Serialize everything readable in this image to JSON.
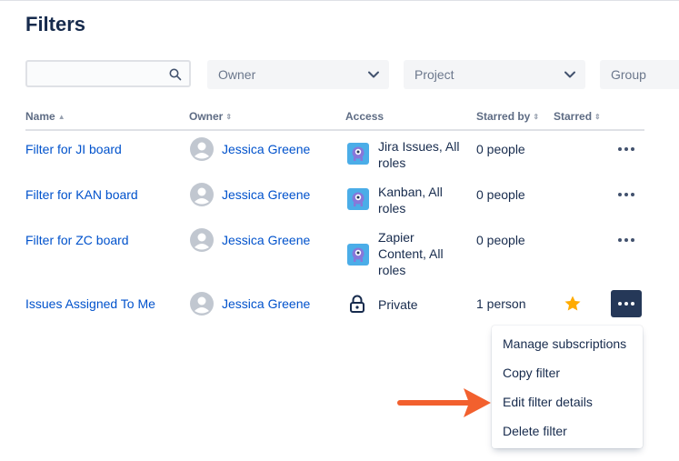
{
  "page": {
    "title": "Filters"
  },
  "filters": {
    "search_value": "",
    "owner_label": "Owner",
    "project_label": "Project",
    "group_label": "Group"
  },
  "columns": {
    "name": "Name",
    "owner": "Owner",
    "access": "Access",
    "starred_by": "Starred by",
    "starred": "Starred"
  },
  "rows": [
    {
      "name": "Filter for JI board",
      "owner": "Jessica Greene",
      "access": "Jira Issues, All roles",
      "access_icon": "project-icon",
      "starred_by": "0 people",
      "starred": false
    },
    {
      "name": "Filter for KAN board",
      "owner": "Jessica Greene",
      "access": "Kanban, All roles",
      "access_icon": "project-icon",
      "starred_by": "0 people",
      "starred": false
    },
    {
      "name": "Filter for ZC board",
      "owner": "Jessica Greene",
      "access": "Zapier Content, All roles",
      "access_icon": "project-icon",
      "starred_by": "0 people",
      "starred": false
    },
    {
      "name": "Issues Assigned To Me",
      "owner": "Jessica Greene",
      "access": "Private",
      "access_icon": "lock-icon",
      "starred_by": "1 person",
      "starred": true
    }
  ],
  "menu": {
    "items": [
      "Manage subscriptions",
      "Copy filter",
      "Edit filter details",
      "Delete filter"
    ]
  },
  "colors": {
    "link": "#0052cc",
    "text": "#172b4d",
    "star": "#ffab00",
    "active_button": "#253858",
    "annotation_arrow": "#f2602e"
  }
}
